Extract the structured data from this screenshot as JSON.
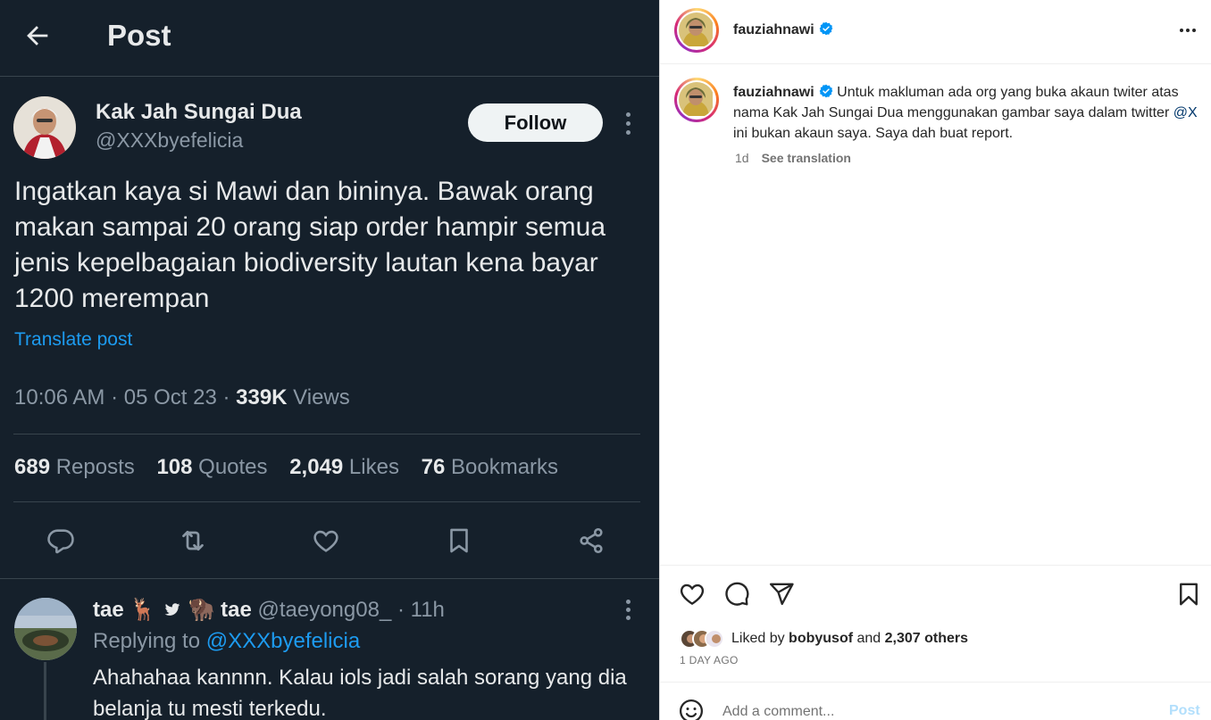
{
  "twitter": {
    "header": {
      "title": "Post"
    },
    "author": {
      "name": "Kak Jah Sungai Dua",
      "handle": "@XXXbyefelicia"
    },
    "follow_label": "Follow",
    "body": "Ingatkan kaya si Mawi dan bininya. Bawak orang makan sampai 20 orang siap order hampir semua jenis kepelbagaian biodiversity lautan kena bayar 1200 merempan",
    "translate_label": "Translate post",
    "meta": {
      "time": "10:06 AM",
      "sep": " · ",
      "date": "05 Oct 23",
      "views_count": "339K",
      "views_label": " Views"
    },
    "stats": {
      "reposts_count": "689",
      "reposts_label": " Reposts",
      "quotes_count": "108",
      "quotes_label": " Quotes",
      "likes_count": "2,049",
      "likes_label": " Likes",
      "bookmarks_count": "76",
      "bookmarks_label": " Bookmarks"
    },
    "action_icons": [
      "reply-icon",
      "repost-icon",
      "like-icon",
      "bookmark-icon",
      "share-icon"
    ],
    "reply": {
      "name_part1": "tae 🦌 ",
      "name_part2": " 🦬 tae",
      "handle": " @taeyong08_",
      "time": " · 11h",
      "replying_prefix": "Replying to ",
      "replying_to": "@XXXbyefelicia",
      "text": "Ahahahaa kannnn. Kalau iols jadi salah sorang yang dia belanja tu mesti terkedu."
    },
    "colors": {
      "background": "#15202b",
      "accent": "#1d9bf0",
      "muted": "#8b98a5"
    }
  },
  "instagram": {
    "username": "fauziahnawi",
    "caption": {
      "username": "fauziahnawi",
      "text_before_mention": " Untuk makluman ada org yang buka akaun twiter atas nama Kak Jah Sungai Dua menggunakan gambar saya dalam twitter ",
      "mention": "@X",
      "text_after_mention": " ini bukan akaun saya. Saya dah buat report."
    },
    "caption_age": "1d",
    "see_translation": "See translation",
    "likes": {
      "prefix": "Liked by ",
      "user": "bobyusof",
      "middle": " and ",
      "others": "2,307 others"
    },
    "post_age": "1 DAY AGO",
    "comment_placeholder": "Add a comment...",
    "post_label": "Post",
    "action_icons": [
      "heart-icon",
      "comment-icon",
      "share-icon",
      "save-icon"
    ],
    "colors": {
      "text": "#262626",
      "muted": "#737373",
      "verified": "#0095f6",
      "post_disabled": "#b2dffc"
    }
  }
}
